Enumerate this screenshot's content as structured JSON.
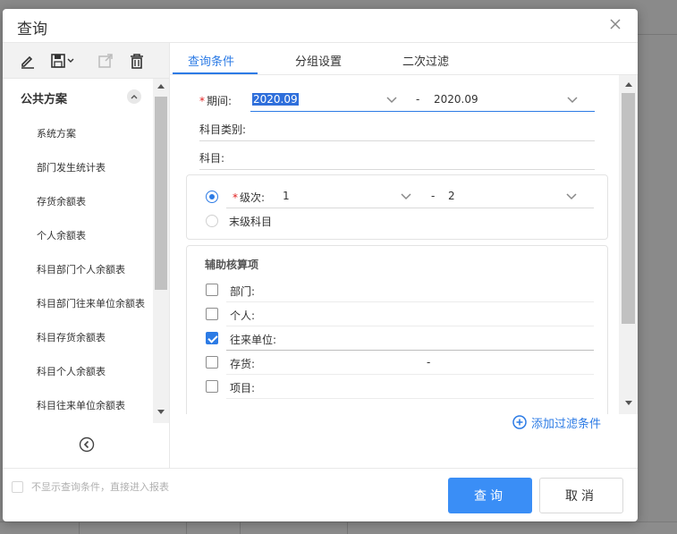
{
  "dialog": {
    "title": "查询"
  },
  "toolbar": {
    "icons": [
      "edit-icon",
      "save-icon",
      "export-icon",
      "delete-icon"
    ]
  },
  "plans": {
    "group_label": "公共方案",
    "items": [
      "系统方案",
      "部门发生统计表",
      "存货余额表",
      "个人余额表",
      "科目部门个人余额表",
      "科目部门往来单位余额表",
      "科目存货余额表",
      "科目个人余额表",
      "科目往来单位余额表"
    ]
  },
  "tabs": [
    {
      "label": "查询条件",
      "active": true
    },
    {
      "label": "分组设置",
      "active": false
    },
    {
      "label": "二次过滤",
      "active": false
    }
  ],
  "form": {
    "period": {
      "label": "期间:",
      "required": true,
      "from": "2020.09",
      "separator": "-",
      "to": "2020.09"
    },
    "subject_type": {
      "label": "科目类别:"
    },
    "subject": {
      "label": "科目:"
    },
    "level": {
      "label": "级次:",
      "required": true,
      "from": "1",
      "separator": "-",
      "to": "2",
      "selected": true
    },
    "last_level": {
      "label": "末级科目",
      "selected": false
    },
    "aux": {
      "title": "辅助核算项",
      "items": [
        {
          "label": "部门:",
          "checked": false,
          "value": ""
        },
        {
          "label": "个人:",
          "checked": false,
          "value": ""
        },
        {
          "label": "往来单位:",
          "checked": true,
          "value": ""
        },
        {
          "label": "存货:",
          "checked": false,
          "value": "-"
        },
        {
          "label": "项目:",
          "checked": false,
          "value": ""
        }
      ]
    }
  },
  "add_filter": {
    "label": "添加过滤条件"
  },
  "footer": {
    "skip_text": "不显示查询条件，直接进入报表",
    "query_label": "查询",
    "cancel_label": "取消"
  },
  "colors": {
    "accent": "#2c7be5",
    "primary_button": "#3a8ef6",
    "required": "#e02020"
  }
}
